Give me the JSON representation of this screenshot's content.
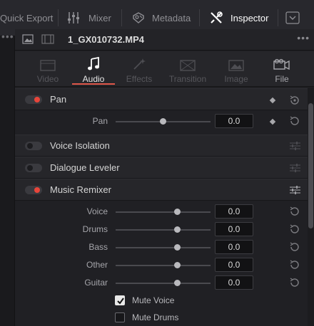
{
  "toolbar": {
    "quick_export": "Quick Export",
    "mixer": "Mixer",
    "metadata": "Metadata",
    "inspector": "Inspector",
    "icons": [
      "mixer-icon",
      "metadata-icon",
      "inspector-icon",
      "chevron-down-icon"
    ]
  },
  "clip": {
    "filename": "1_GX010732.MP4"
  },
  "tabs": [
    {
      "label": "Video",
      "state": "disabled",
      "icon": "video-icon"
    },
    {
      "label": "Audio",
      "state": "active",
      "icon": "music-note-icon"
    },
    {
      "label": "Effects",
      "state": "disabled",
      "icon": "effects-icon"
    },
    {
      "label": "Transition",
      "state": "disabled",
      "icon": "transition-icon"
    },
    {
      "label": "Image",
      "state": "disabled",
      "icon": "image-icon"
    },
    {
      "label": "File",
      "state": "enabled",
      "icon": "file-icon"
    }
  ],
  "sections": {
    "pan": {
      "title": "Pan",
      "enabled": true,
      "param_label": "Pan",
      "value": "0.0",
      "slider_fraction": 0.5
    },
    "voice_isolation": {
      "title": "Voice Isolation",
      "enabled": false
    },
    "dialogue_leveler": {
      "title": "Dialogue Leveler",
      "enabled": false
    },
    "music_remixer": {
      "title": "Music Remixer",
      "enabled": true,
      "params": [
        {
          "label": "Voice",
          "value": "0.0",
          "slider_fraction": 0.65
        },
        {
          "label": "Drums",
          "value": "0.0",
          "slider_fraction": 0.65
        },
        {
          "label": "Bass",
          "value": "0.0",
          "slider_fraction": 0.65
        },
        {
          "label": "Other",
          "value": "0.0",
          "slider_fraction": 0.65
        },
        {
          "label": "Guitar",
          "value": "0.0",
          "slider_fraction": 0.65
        }
      ],
      "checkboxes": [
        {
          "label": "Mute Voice",
          "checked": true
        },
        {
          "label": "Mute Drums",
          "checked": false
        }
      ]
    }
  },
  "colors": {
    "accent": "#e8453a",
    "active_tab_underline": "#e0574a",
    "panel_bg": "#202024"
  }
}
